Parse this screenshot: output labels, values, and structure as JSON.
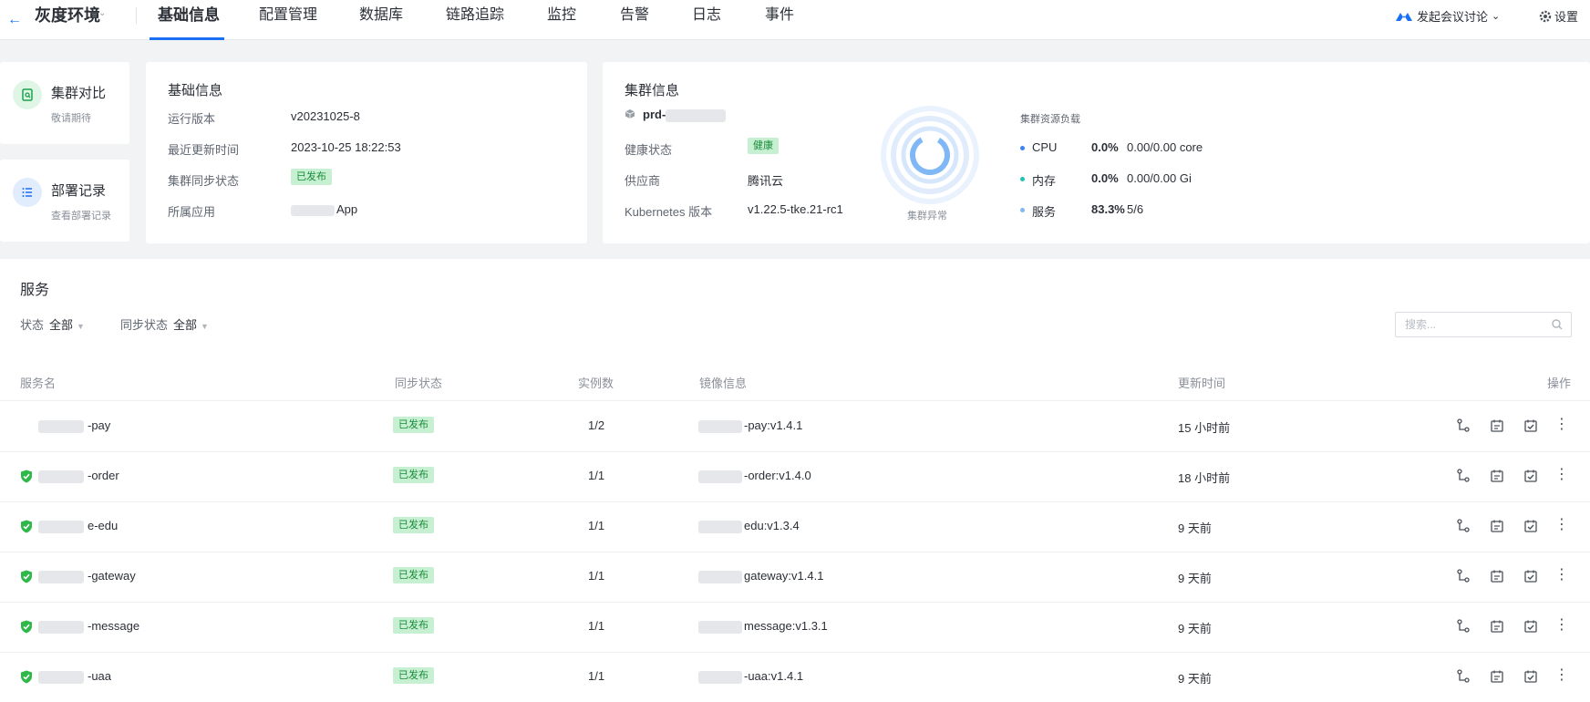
{
  "nav": {
    "env_title": "灰度环境",
    "tabs": [
      "基础信息",
      "配置管理",
      "数据库",
      "链路追踪",
      "监控",
      "告警",
      "日志",
      "事件"
    ],
    "meeting_label": "发起会议讨论",
    "settings_label": "设置"
  },
  "side_cards": [
    {
      "title": "集群对比",
      "sub": "敬请期待"
    },
    {
      "title": "部署记录",
      "sub": "查看部署记录"
    }
  ],
  "basic_info": {
    "title": "基础信息",
    "rows": [
      {
        "label": "运行版本",
        "value": "v20231025-8"
      },
      {
        "label": "最近更新时间",
        "value": "2023-10-25 18:22:53"
      },
      {
        "label": "集群同步状态",
        "value": "已发布"
      },
      {
        "label": "所属应用",
        "value": "App"
      }
    ]
  },
  "cluster_info": {
    "title": "集群信息",
    "cluster_name": "prd-",
    "rows": [
      {
        "label": "健康状态",
        "value": "健康"
      },
      {
        "label": "供应商",
        "value": "腾讯云"
      },
      {
        "label": "Kubernetes 版本",
        "value": "v1.22.5-tke.21-rc1"
      }
    ],
    "ring_label": "集群异常",
    "load_title": "集群资源负载",
    "load": [
      {
        "name": "CPU",
        "pct": "0.0%",
        "detail": "0.00/0.00 core",
        "color": "#3b82f6"
      },
      {
        "name": "内存",
        "pct": "0.0%",
        "detail": "0.00/0.00 Gi",
        "color": "#22c3b0"
      },
      {
        "name": "服务",
        "pct": "83.3%",
        "detail": "5/6",
        "color": "#7fb8f5"
      }
    ]
  },
  "services": {
    "title": "服务",
    "filters": [
      {
        "label": "状态",
        "value": "全部"
      },
      {
        "label": "同步状态",
        "value": "全部"
      }
    ],
    "search_placeholder": "搜索...",
    "columns": [
      "服务名",
      "同步状态",
      "实例数",
      "镜像信息",
      "更新时间",
      "操作"
    ],
    "rows": [
      {
        "name": "-pay",
        "healthy": false,
        "sync": "已发布",
        "instances": "1/2",
        "image": "-pay:v1.4.1",
        "updated": "15 小时前"
      },
      {
        "name": "-order",
        "healthy": true,
        "sync": "已发布",
        "instances": "1/1",
        "image": "-order:v1.4.0",
        "updated": "18 小时前"
      },
      {
        "name": "e-edu",
        "healthy": true,
        "sync": "已发布",
        "instances": "1/1",
        "image": "edu:v1.3.4",
        "updated": "9 天前"
      },
      {
        "name": "-gateway",
        "healthy": true,
        "sync": "已发布",
        "instances": "1/1",
        "image": "gateway:v1.4.1",
        "updated": "9 天前"
      },
      {
        "name": "-message",
        "healthy": true,
        "sync": "已发布",
        "instances": "1/1",
        "image": "message:v1.3.1",
        "updated": "9 天前"
      },
      {
        "name": "-uaa",
        "healthy": true,
        "sync": "已发布",
        "instances": "1/1",
        "image": "-uaa:v1.4.1",
        "updated": "9 天前"
      }
    ]
  },
  "colors": {
    "accent": "#1b6ff5",
    "success_bg": "#c7f0d2",
    "success_text": "#1a8a3a",
    "shield": "#2eb84a"
  }
}
